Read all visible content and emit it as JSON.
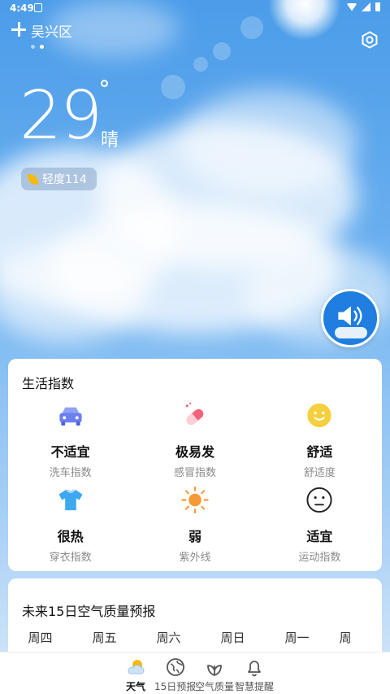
{
  "status": {
    "time": "4:49"
  },
  "header": {
    "city": "吴兴区"
  },
  "current": {
    "temperature": "29",
    "condition": "晴",
    "aqi_label": "轻度114"
  },
  "life": {
    "title": "生活指数",
    "items": [
      {
        "value": "不适宜",
        "label": "洗车指数",
        "icon": "car-icon",
        "color": "#6b7ff0"
      },
      {
        "value": "极易发",
        "label": "感冒指数",
        "icon": "pill-icon",
        "color": "#f2647a"
      },
      {
        "value": "舒适",
        "label": "舒适度",
        "icon": "smiley-icon",
        "color": "#f5cf3c"
      },
      {
        "value": "很热",
        "label": "穿衣指数",
        "icon": "shirt-icon",
        "color": "#3ea8f0"
      },
      {
        "value": "弱",
        "label": "紫外线",
        "icon": "sun-icon",
        "color": "#f59a35"
      },
      {
        "value": "适宜",
        "label": "运动指数",
        "icon": "face-icon",
        "color": "#333333"
      }
    ]
  },
  "air": {
    "title": "未来15日空气质量预报",
    "days": [
      {
        "day": "周四"
      },
      {
        "day": "周五"
      },
      {
        "day": "周六"
      },
      {
        "day": "周日"
      },
      {
        "day": "周一"
      },
      {
        "day": "周"
      }
    ]
  },
  "nav": {
    "tabs": [
      {
        "label": "天气",
        "active": true
      },
      {
        "label": "15日预报",
        "active": false
      },
      {
        "label": "空气质量",
        "active": false
      },
      {
        "label": "智慧提醒",
        "active": false
      }
    ]
  }
}
